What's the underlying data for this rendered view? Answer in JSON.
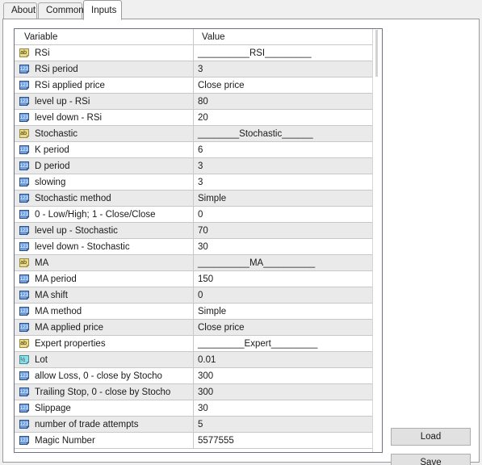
{
  "window": {
    "background_color": "#f0f0f0",
    "panel_color": "#ffffff"
  },
  "tabs": [
    {
      "label": "About",
      "active": false
    },
    {
      "label": "Common",
      "active": false
    },
    {
      "label": "Inputs",
      "active": true
    }
  ],
  "grid": {
    "columns": [
      "Variable",
      "Value"
    ],
    "rows": [
      {
        "icon": "ab-string-icon",
        "variable": "RSi",
        "value": "__________RSI_________"
      },
      {
        "icon": "123-number-icon",
        "variable": "RSi period",
        "value": "3"
      },
      {
        "icon": "123-number-icon",
        "variable": "RSi applied price",
        "value": "Close price"
      },
      {
        "icon": "123-number-icon",
        "variable": "level up - RSi",
        "value": "80"
      },
      {
        "icon": "123-number-icon",
        "variable": "level down - RSi",
        "value": "20"
      },
      {
        "icon": "ab-string-icon",
        "variable": "Stochastic",
        "value": "________Stochastic______"
      },
      {
        "icon": "123-number-icon",
        "variable": "K period",
        "value": "6"
      },
      {
        "icon": "123-number-icon",
        "variable": "D period",
        "value": "3"
      },
      {
        "icon": "123-number-icon",
        "variable": "slowing",
        "value": "3"
      },
      {
        "icon": "123-number-icon",
        "variable": "Stochastic method",
        "value": "Simple"
      },
      {
        "icon": "123-number-icon",
        "variable": "0 - Low/High; 1 - Close/Close",
        "value": "0"
      },
      {
        "icon": "123-number-icon",
        "variable": "level up - Stochastic",
        "value": "70"
      },
      {
        "icon": "123-number-icon",
        "variable": "level down - Stochastic",
        "value": "30"
      },
      {
        "icon": "ab-string-icon",
        "variable": "MA",
        "value": "__________MA__________"
      },
      {
        "icon": "123-number-icon",
        "variable": "MA period",
        "value": "150"
      },
      {
        "icon": "123-number-icon",
        "variable": "MA shift",
        "value": "0"
      },
      {
        "icon": "123-number-icon",
        "variable": "MA method",
        "value": "Simple"
      },
      {
        "icon": "123-number-icon",
        "variable": "MA applied price",
        "value": "Close price"
      },
      {
        "icon": "ab-string-icon",
        "variable": "Expert properties",
        "value": "_________Expert_________"
      },
      {
        "icon": "half-double-icon",
        "variable": "Lot",
        "value": "0.01"
      },
      {
        "icon": "123-number-icon",
        "variable": "allow Loss, 0 - close by Stocho",
        "value": "300"
      },
      {
        "icon": "123-number-icon",
        "variable": "Trailing Stop, 0 - close by Stocho",
        "value": "300"
      },
      {
        "icon": "123-number-icon",
        "variable": "Slippage",
        "value": "30"
      },
      {
        "icon": "123-number-icon",
        "variable": "number of trade attempts",
        "value": "5"
      },
      {
        "icon": "123-number-icon",
        "variable": "Magic Number",
        "value": "5577555"
      }
    ]
  },
  "buttons": {
    "load_label": "Load",
    "save_label": "Save"
  },
  "colors": {
    "row_alt": "#eaeaea",
    "grid_border": "#6d7480",
    "button_face": "#e1e1e1",
    "icon_string": "#e8d886",
    "icon_number": "#5b8fd6",
    "icon_double": "#7fd4dd"
  }
}
